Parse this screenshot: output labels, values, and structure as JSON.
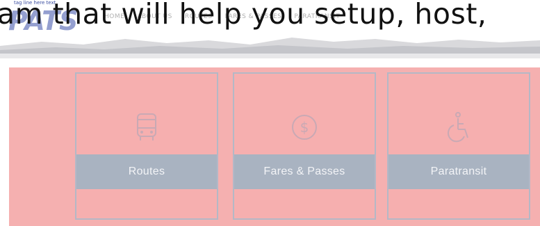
{
  "overlay_text": "am that will help you setup, host,",
  "logo": {
    "tagline": "tag line here text",
    "mark": "PATS"
  },
  "nav": {
    "items": [
      "Home",
      "About Us",
      "Routes",
      "Fares & Passes",
      "Paratransit"
    ]
  },
  "services": [
    {
      "label": "Routes",
      "icon": "bus-icon"
    },
    {
      "label": "Fares & Passes",
      "icon": "dollar-coin-icon"
    },
    {
      "label": "Paratransit",
      "icon": "wheelchair-icon"
    }
  ],
  "colors": {
    "band": "#f5b0b0",
    "card_border": "#b4b8c6",
    "label_bar": "#a9b3c1",
    "label_text": "#f3f4f7"
  }
}
